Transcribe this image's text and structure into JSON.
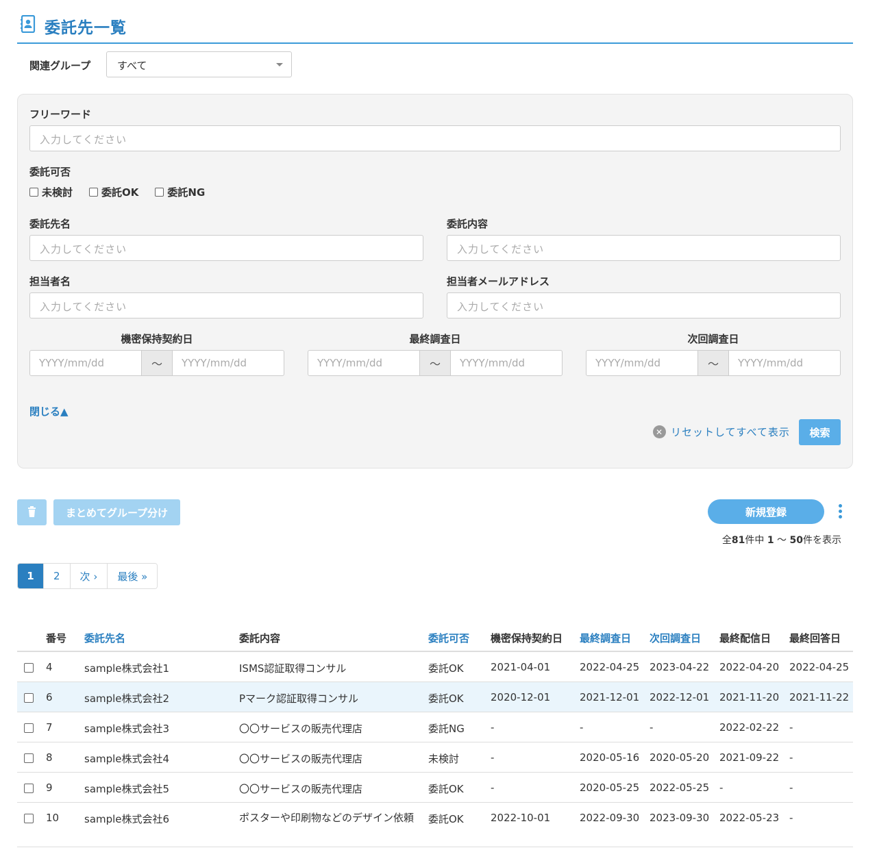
{
  "header": {
    "title": "委託先一覧"
  },
  "group_filter": {
    "label": "関連グループ",
    "selected": "すべて"
  },
  "filters": {
    "freeword_label": "フリーワード",
    "placeholder": "入力してください",
    "status_label": "委託可否",
    "status_options": [
      "未検討",
      "委託OK",
      "委託NG"
    ],
    "name_label": "委託先名",
    "content_label": "委託内容",
    "person_label": "担当者名",
    "email_label": "担当者メールアドレス",
    "date_labels": [
      "機密保持契約日",
      "最終調査日",
      "次回調査日"
    ],
    "date_placeholder": "YYYY/mm/dd",
    "date_sep": "〜",
    "close_label": "閉じる▲",
    "reset_label": "リセットしてすべて表示",
    "search_label": "検索"
  },
  "actions": {
    "group_label": "まとめてグループ分け",
    "new_label": "新規登録",
    "count_prefix": "全",
    "count_total": "81",
    "count_mid": "件中 ",
    "count_from": "1",
    "count_tilde": " 〜 ",
    "count_to": "50",
    "count_suffix": "件を表示"
  },
  "pagination": [
    "1",
    "2",
    "次 ›",
    "最後 »"
  ],
  "table": {
    "headers": [
      "番号",
      "委託先名",
      "委託内容",
      "委託可否",
      "機密保持契約日",
      "最終調査日",
      "次回調査日",
      "最終配信日",
      "最終回答日"
    ],
    "rows": [
      [
        "4",
        "sample株式会社1",
        "ISMS認証取得コンサル",
        "委託OK",
        "2021-04-01",
        "2022-04-25",
        "2023-04-22",
        "2022-04-20",
        "2022-04-25"
      ],
      [
        "6",
        "sample株式会社2",
        "Pマーク認証取得コンサル",
        "委託OK",
        "2020-12-01",
        "2021-12-01",
        "2022-12-01",
        "2021-11-20",
        "2021-11-22"
      ],
      [
        "7",
        "sample株式会社3",
        "〇〇サービスの販売代理店",
        "委託NG",
        "-",
        "-",
        "-",
        "2022-02-22",
        "-"
      ],
      [
        "8",
        "sample株式会社4",
        "〇〇サービスの販売代理店",
        "未検討",
        "-",
        "2020-05-16",
        "2020-05-20",
        "2021-09-22",
        "-"
      ],
      [
        "9",
        "sample株式会社5",
        "〇〇サービスの販売代理店",
        "委託OK",
        "-",
        "2020-05-25",
        "2022-05-25",
        "-",
        "-"
      ],
      [
        "10",
        "sample株式会社6",
        "ポスターや印刷物などのデザイン依頼",
        "委託OK",
        "2022-10-01",
        "2022-09-30",
        "2023-09-30",
        "2022-05-23",
        "-"
      ]
    ]
  },
  "colors": {
    "accent": "#2a7fc0",
    "button": "#5aaee8",
    "disabled": "#a3d3f2",
    "highlight_row": "#eaf5fc"
  }
}
